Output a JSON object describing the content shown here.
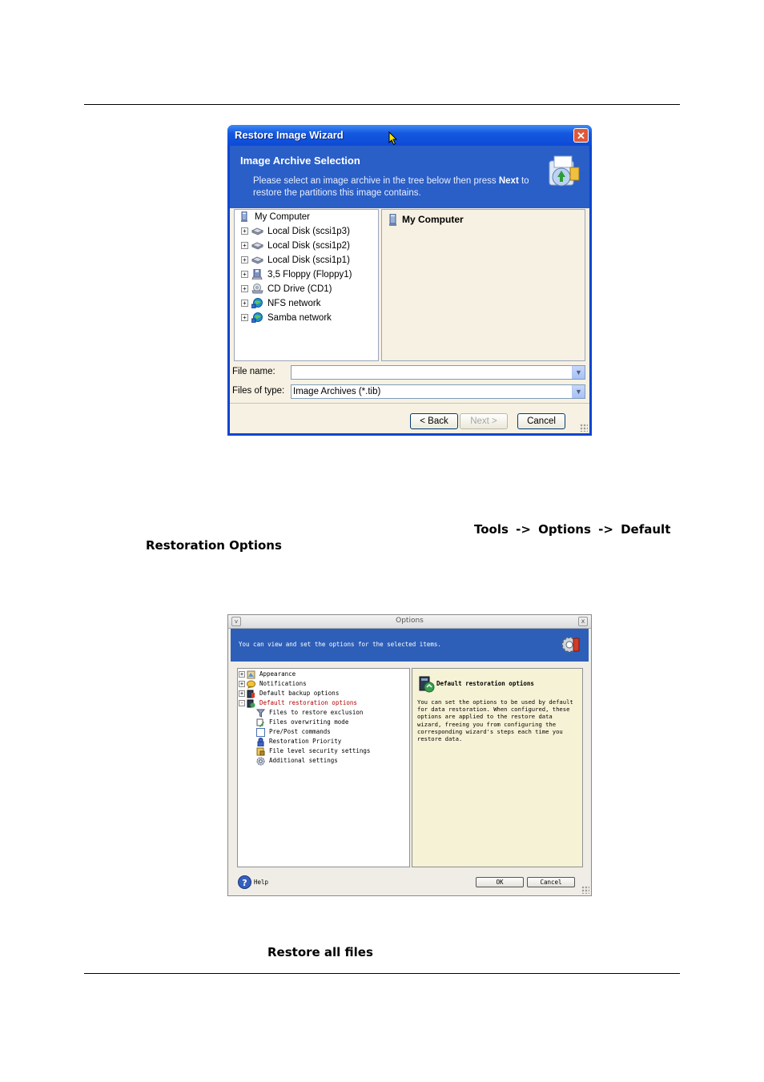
{
  "page_text": {
    "menu_path_part1": "Tools  ->  Options  ->  Default",
    "menu_path_part2": "Restoration Options",
    "restore_all_files": "Restore all files"
  },
  "wizard": {
    "title": "Restore Image Wizard",
    "close_glyph": "✕",
    "header_title": "Image Archive Selection",
    "header_desc_pre": "Please select an image archive in the tree below then press ",
    "header_desc_bold": "Next",
    "header_desc_post": " to restore the partitions this image contains.",
    "tree": [
      {
        "label": "My Computer",
        "icon": "computer-icon"
      },
      {
        "label": "Local Disk (scsi1p3)",
        "icon": "disk-icon"
      },
      {
        "label": "Local Disk (scsi1p2)",
        "icon": "disk-icon"
      },
      {
        "label": "Local Disk (scsi1p1)",
        "icon": "disk-icon"
      },
      {
        "label": "3,5 Floppy (Floppy1)",
        "icon": "floppy-icon"
      },
      {
        "label": "CD Drive (CD1)",
        "icon": "cd-icon"
      },
      {
        "label": "NFS network",
        "icon": "network-icon"
      },
      {
        "label": "Samba network",
        "icon": "network-icon"
      }
    ],
    "detail_item": "My Computer",
    "file_name_label": "File name:",
    "file_name_value": "",
    "files_of_type_label": "Files of type:",
    "files_of_type_value": "Image Archives (*.tib)",
    "back_label": "< Back",
    "next_label": "Next >",
    "cancel_label": "Cancel",
    "combo_arrow": "▼",
    "expander": "+"
  },
  "options": {
    "title": "Options",
    "min_glyph": "v",
    "close_glyph": "x",
    "header_text": "You can view and set the options for the selected items.",
    "tree": [
      {
        "label": "Appearance",
        "expander": "+"
      },
      {
        "label": "Notifications",
        "expander": "+"
      },
      {
        "label": "Default backup options",
        "expander": "+"
      },
      {
        "label": "Default restoration options",
        "expander": "-"
      },
      {
        "label": "Files to restore exclusion"
      },
      {
        "label": "Files overwriting mode"
      },
      {
        "label": "Pre/Post commands"
      },
      {
        "label": "Restoration Priority"
      },
      {
        "label": "File level security settings"
      },
      {
        "label": "Additional settings"
      }
    ],
    "detail_title": "Default restoration options",
    "detail_text": "You can set the options to be used by default for data restoration. When configured, these options are applied to the restore data wizard, freeing you from configuring the corresponding wizard's steps each time you restore data.",
    "help_label": "Help",
    "ok_label": "OK",
    "cancel_label": "Cancel"
  }
}
